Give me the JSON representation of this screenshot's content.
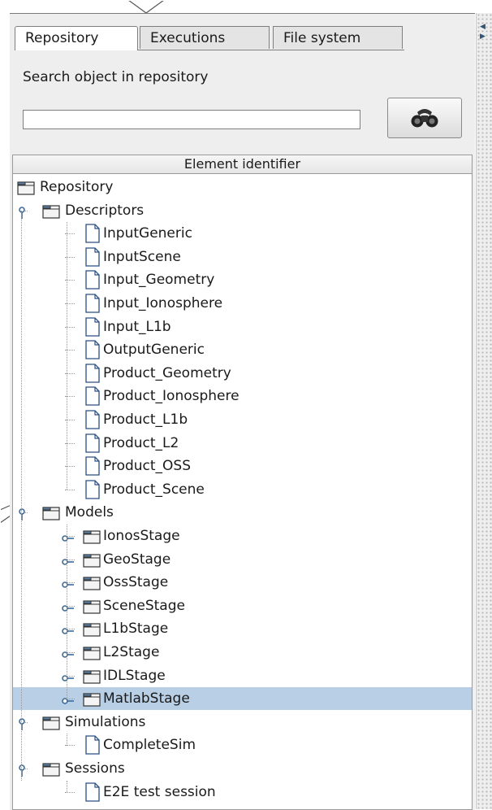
{
  "tabs": [
    "Repository",
    "Executions",
    "File system"
  ],
  "active_tab": "Repository",
  "search": {
    "label": "Search object in repository",
    "value": "",
    "button_icon": "binoculars-icon"
  },
  "tree": {
    "header": "Element identifier",
    "nodes": [
      {
        "label": "Repository",
        "type": "folder",
        "level": 0,
        "expanded": true
      },
      {
        "label": "Descriptors",
        "type": "folder",
        "level": 1,
        "expanded": true
      },
      {
        "label": "InputGeneric",
        "type": "document",
        "level": 2
      },
      {
        "label": "InputScene",
        "type": "document",
        "level": 2
      },
      {
        "label": "Input_Geometry",
        "type": "document",
        "level": 2
      },
      {
        "label": "Input_Ionosphere",
        "type": "document",
        "level": 2
      },
      {
        "label": "Input_L1b",
        "type": "document",
        "level": 2
      },
      {
        "label": "OutputGeneric",
        "type": "document",
        "level": 2
      },
      {
        "label": "Product_Geometry",
        "type": "document",
        "level": 2
      },
      {
        "label": "Product_Ionosphere",
        "type": "document",
        "level": 2
      },
      {
        "label": "Product_L1b",
        "type": "document",
        "level": 2
      },
      {
        "label": "Product_L2",
        "type": "document",
        "level": 2
      },
      {
        "label": "Product_OSS",
        "type": "document",
        "level": 2
      },
      {
        "label": "Product_Scene",
        "type": "document",
        "level": 2
      },
      {
        "label": "Models",
        "type": "folder",
        "level": 1,
        "expanded": true
      },
      {
        "label": "IonosStage",
        "type": "folder",
        "level": 2,
        "expanded": false
      },
      {
        "label": "GeoStage",
        "type": "folder",
        "level": 2,
        "expanded": false
      },
      {
        "label": "OssStage",
        "type": "folder",
        "level": 2,
        "expanded": false
      },
      {
        "label": "SceneStage",
        "type": "folder",
        "level": 2,
        "expanded": false
      },
      {
        "label": "L1bStage",
        "type": "folder",
        "level": 2,
        "expanded": false
      },
      {
        "label": "L2Stage",
        "type": "folder",
        "level": 2,
        "expanded": false
      },
      {
        "label": "IDLStage",
        "type": "folder",
        "level": 2,
        "expanded": false
      },
      {
        "label": "MatlabStage",
        "type": "folder",
        "level": 2,
        "expanded": false,
        "selected": true
      },
      {
        "label": "Simulations",
        "type": "folder",
        "level": 1,
        "expanded": true
      },
      {
        "label": "CompleteSim",
        "type": "document",
        "level": 2
      },
      {
        "label": "Sessions",
        "type": "folder",
        "level": 1,
        "expanded": true
      },
      {
        "label": "E2E test session",
        "type": "document",
        "level": 2
      }
    ]
  },
  "colors": {
    "selection": "#b8cfe5",
    "panel": "#eeeeee"
  }
}
